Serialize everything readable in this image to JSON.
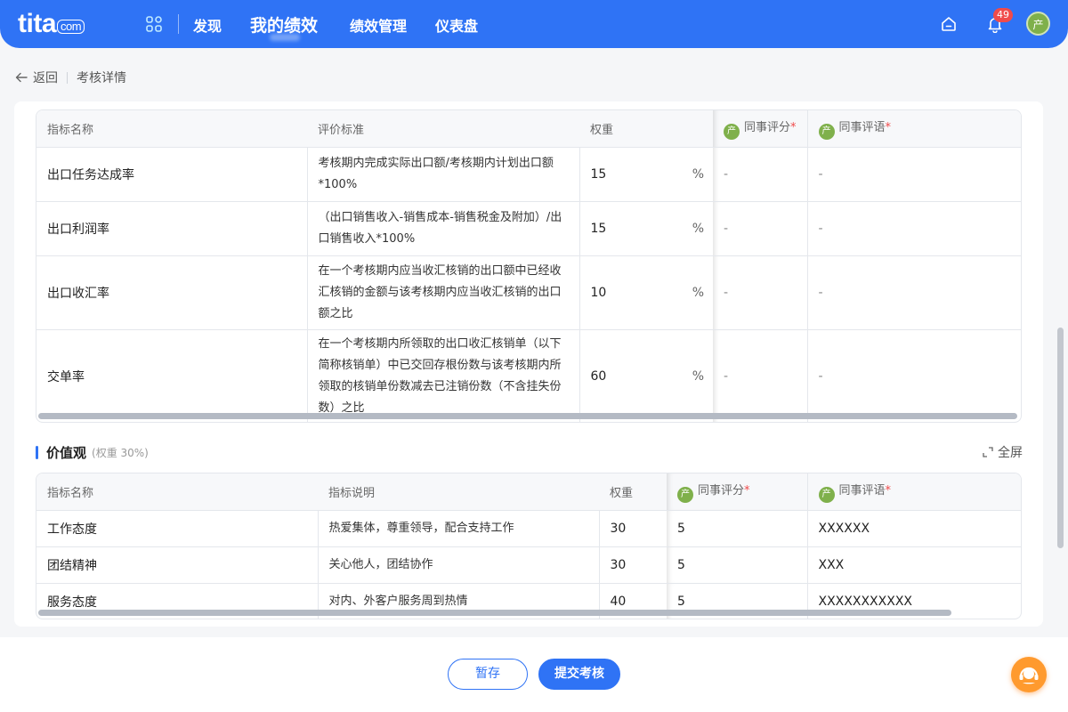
{
  "header": {
    "logo_main": "tita",
    "logo_suffix": "com",
    "nav": [
      {
        "label": "发现"
      },
      {
        "label": "我的绩效"
      },
      {
        "label": "绩效管理"
      },
      {
        "label": "仪表盘"
      }
    ],
    "notification_count": "49",
    "avatar_text": "产"
  },
  "breadcrumb": {
    "back_label": "返回",
    "current": "考核详情"
  },
  "kpi_table": {
    "headers": {
      "name": "指标名称",
      "standard": "评价标准",
      "weight": "权重",
      "peer_score": "同事评分",
      "peer_comment": "同事评语",
      "required_mark": "*"
    },
    "peer_avatar": "产",
    "rows": [
      {
        "name": "出口任务达成率",
        "standard": "考核期内完成实际出口额/考核期内计划出口额*100%",
        "weight": "15",
        "unit": "%",
        "score": "-",
        "comment": "-"
      },
      {
        "name": "出口利润率",
        "standard": "（出口销售收入-销售成本-销售税金及附加）/出口销售收入*100%",
        "weight": "15",
        "unit": "%",
        "score": "-",
        "comment": "-"
      },
      {
        "name": "出口收汇率",
        "standard": "在一个考核期内应当收汇核销的出口额中已经收汇核销的金额与该考核期内应当收汇核销的出口额之比",
        "weight": "10",
        "unit": "%",
        "score": "-",
        "comment": "-"
      },
      {
        "name": "交单率",
        "standard": "在一个考核期内所领取的出口收汇核销单（以下简称核销单）中已交回存根份数与该考核期内所领取的核销单份数减去已注销份数（不含挂失份数）之比",
        "weight": "60",
        "unit": "%",
        "score": "-",
        "comment": "-"
      }
    ]
  },
  "values_section": {
    "title": "价值观",
    "weight_note": "(权重 30%)",
    "fullscreen_label": "全屏",
    "headers": {
      "name": "指标名称",
      "desc": "指标说明",
      "weight": "权重",
      "peer_score": "同事评分",
      "peer_comment": "同事评语",
      "required_mark": "*"
    },
    "peer_avatar": "产",
    "rows": [
      {
        "name": "工作态度",
        "desc": "热爱集体，尊重领导，配合支持工作",
        "weight": "30",
        "score": "5",
        "comment": "XXXXXX"
      },
      {
        "name": "团结精神",
        "desc": "关心他人，团结协作",
        "weight": "30",
        "score": "5",
        "comment": "XXX"
      },
      {
        "name": "服务态度",
        "desc": "对内、外客户服务周到热情",
        "weight": "40",
        "score": "5",
        "comment": "XXXXXXXXXXX"
      }
    ]
  },
  "footer": {
    "save_label": "暂存",
    "submit_label": "提交考核"
  },
  "colors": {
    "primary": "#2f73f5",
    "badge": "#f04b4b",
    "avatar": "#7fb04b",
    "help": "#ff9a2e"
  }
}
